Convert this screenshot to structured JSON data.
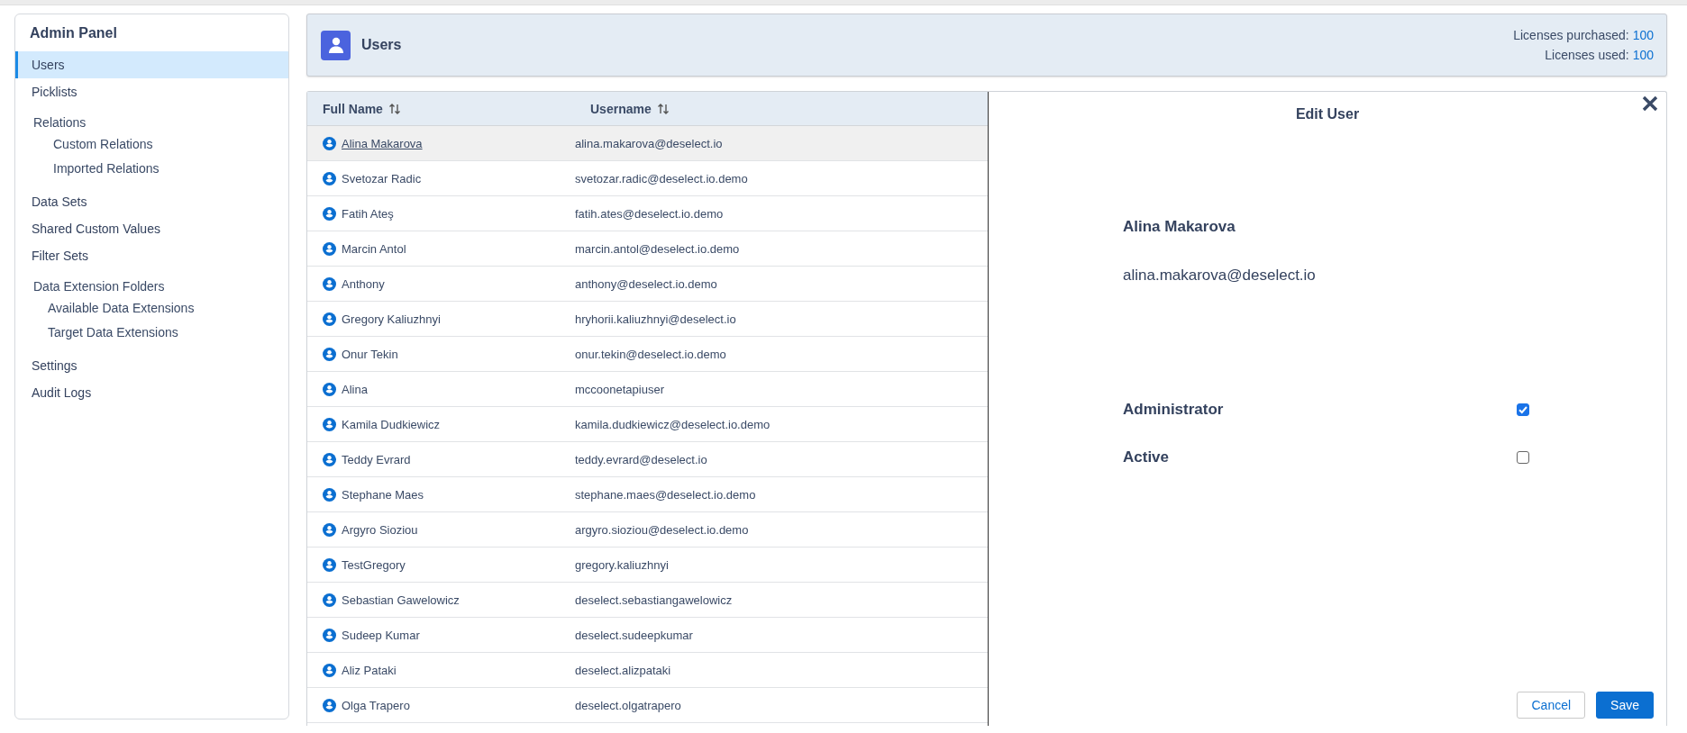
{
  "sidebar": {
    "title": "Admin Panel",
    "items": [
      {
        "label": "Users",
        "selected": true,
        "kind": "link"
      },
      {
        "label": "Picklists",
        "selected": false,
        "kind": "link"
      },
      {
        "label": "Relations",
        "kind": "group",
        "children": [
          {
            "label": "Custom Relations",
            "selected": false
          },
          {
            "label": "Imported Relations",
            "selected": false
          }
        ]
      },
      {
        "label": "Data Sets",
        "selected": false,
        "kind": "link"
      },
      {
        "label": "Shared Custom Values",
        "selected": false,
        "kind": "link"
      },
      {
        "label": "Filter Sets",
        "selected": false,
        "kind": "link"
      },
      {
        "label": "Data Extension Folders",
        "kind": "group",
        "children": [
          {
            "label": "Available Data Extensions",
            "selected": false
          },
          {
            "label": "Target Data Extensions",
            "selected": false
          }
        ]
      },
      {
        "label": "Settings",
        "selected": false,
        "kind": "link"
      },
      {
        "label": "Audit Logs",
        "selected": false,
        "kind": "link"
      }
    ]
  },
  "header": {
    "title": "Users",
    "licenses": [
      {
        "label": "Licenses purchased:",
        "value": "100"
      },
      {
        "label": "Licenses used:",
        "value": "100"
      }
    ]
  },
  "table": {
    "columns": [
      "Full Name",
      "Username"
    ],
    "rows": [
      {
        "full_name": "Alina Makarova",
        "username": "alina.makarova@deselect.io",
        "selected": true
      },
      {
        "full_name": "Svetozar Radic",
        "username": "svetozar.radic@deselect.io.demo",
        "selected": false
      },
      {
        "full_name": "Fatih Ateş",
        "username": "fatih.ates@deselect.io.demo",
        "selected": false
      },
      {
        "full_name": "Marcin Antol",
        "username": "marcin.antol@deselect.io.demo",
        "selected": false
      },
      {
        "full_name": "Anthony",
        "username": "anthony@deselect.io.demo",
        "selected": false
      },
      {
        "full_name": "Gregory Kaliuzhnyi",
        "username": "hryhorii.kaliuzhnyi@deselect.io",
        "selected": false
      },
      {
        "full_name": "Onur Tekin",
        "username": "onur.tekin@deselect.io.demo",
        "selected": false
      },
      {
        "full_name": "Alina",
        "username": "mccoonetapiuser",
        "selected": false
      },
      {
        "full_name": "Kamila Dudkiewicz",
        "username": "kamila.dudkiewicz@deselect.io.demo",
        "selected": false
      },
      {
        "full_name": "Teddy Evrard",
        "username": "teddy.evrard@deselect.io",
        "selected": false
      },
      {
        "full_name": "Stephane Maes",
        "username": "stephane.maes@deselect.io.demo",
        "selected": false
      },
      {
        "full_name": "Argyro Sioziou",
        "username": "argyro.sioziou@deselect.io.demo",
        "selected": false
      },
      {
        "full_name": "TestGregory",
        "username": "gregory.kaliuzhnyi",
        "selected": false
      },
      {
        "full_name": "Sebastian Gawelowicz",
        "username": "deselect.sebastiangawelowicz",
        "selected": false
      },
      {
        "full_name": "Sudeep Kumar",
        "username": "deselect.sudeepkumar",
        "selected": false
      },
      {
        "full_name": "Aliz Pataki",
        "username": "deselect.alizpataki",
        "selected": false
      },
      {
        "full_name": "Olga Trapero",
        "username": "deselect.olgatrapero",
        "selected": false
      }
    ]
  },
  "edit_user": {
    "title": "Edit User",
    "name": "Alina Makarova",
    "email": "alina.makarova@deselect.io",
    "fields": [
      {
        "label": "Administrator",
        "checked": true
      },
      {
        "label": "Active",
        "checked": false
      }
    ],
    "buttons": [
      {
        "label": "Cancel",
        "kind": "secondary"
      },
      {
        "label": "Save",
        "kind": "primary"
      }
    ]
  }
}
